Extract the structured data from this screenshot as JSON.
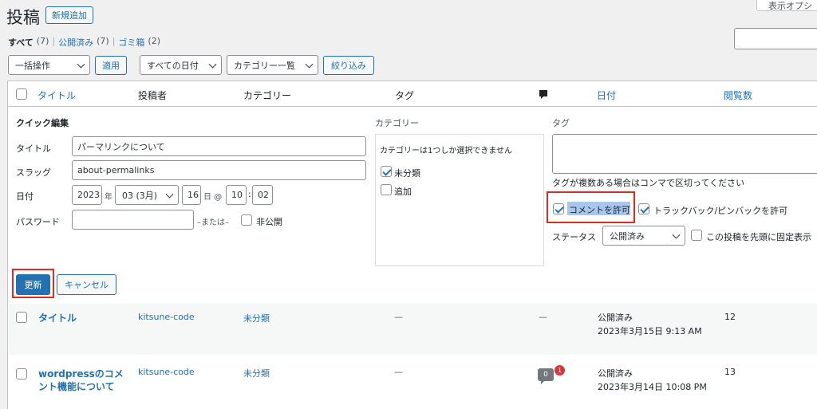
{
  "header": {
    "title": "投稿",
    "add_new": "新規追加",
    "screen_options": "表示オプシ"
  },
  "filters": {
    "all": "すべて",
    "all_count": "(7)",
    "published": "公開済み",
    "published_count": "(7)",
    "trash": "ゴミ箱",
    "trash_count": "(2)",
    "sep": "|"
  },
  "toolbar": {
    "bulk_action": "一括操作",
    "apply": "適用",
    "dates": "すべての日付",
    "categories": "カテゴリー一覧",
    "filter": "絞り込み"
  },
  "columns": {
    "title": "タイトル",
    "author": "投稿者",
    "category": "カテゴリー",
    "tags": "タグ",
    "date": "日付",
    "views": "閲覧数"
  },
  "quick_edit": {
    "heading": "クイック編集",
    "title_label": "タイトル",
    "title_value": "パーマリンクについて",
    "slug_label": "スラッグ",
    "slug_value": "about-permalinks",
    "date_label": "日付",
    "year": "2023",
    "year_unit": "年",
    "month": "03 (3月)",
    "day": "16",
    "day_unit": "日 @",
    "hour": "10",
    "colon": ":",
    "minute": "02",
    "password_label": "パスワード",
    "or": "–または–",
    "private_label": "非公開",
    "category_heading": "カテゴリー",
    "category_note": "カテゴリーは1つしか選択できません",
    "cat_uncategorized": "未分類",
    "cat_add": "追加",
    "tags_heading": "タグ",
    "tags_hint": "タグが複数ある場合はコンマで区切ってください",
    "allow_comments": "コメントを許可",
    "allow_pings": "トラックバック/ピンバックを許可",
    "status_label": "ステータス",
    "status_value": "公開済み",
    "sticky_label": "この投稿を先頭に固定表示",
    "update": "更新",
    "cancel": "キャンセル"
  },
  "rows": [
    {
      "title": "タイトル",
      "author": "kitsune-code",
      "category": "未分類",
      "tags": "—",
      "comments": "—",
      "status": "公開済み",
      "date": "2023年3月15日 9:13 AM",
      "views": "12"
    },
    {
      "title_line1": "wordpressのコメ",
      "title_line2": "ント機能について",
      "author": "kitsune-code",
      "category": "未分類",
      "tags": "—",
      "comment_count": "0",
      "pending_count": "1",
      "status": "公開済み",
      "date": "2023年3月14日 10:08 PM",
      "views": "13"
    }
  ],
  "colors": {
    "accent": "#2271b1",
    "primary_button": "#2271b1",
    "highlight_border": "#e02b20",
    "pending_badge": "#d63638",
    "selection": "#a7c7ef"
  }
}
